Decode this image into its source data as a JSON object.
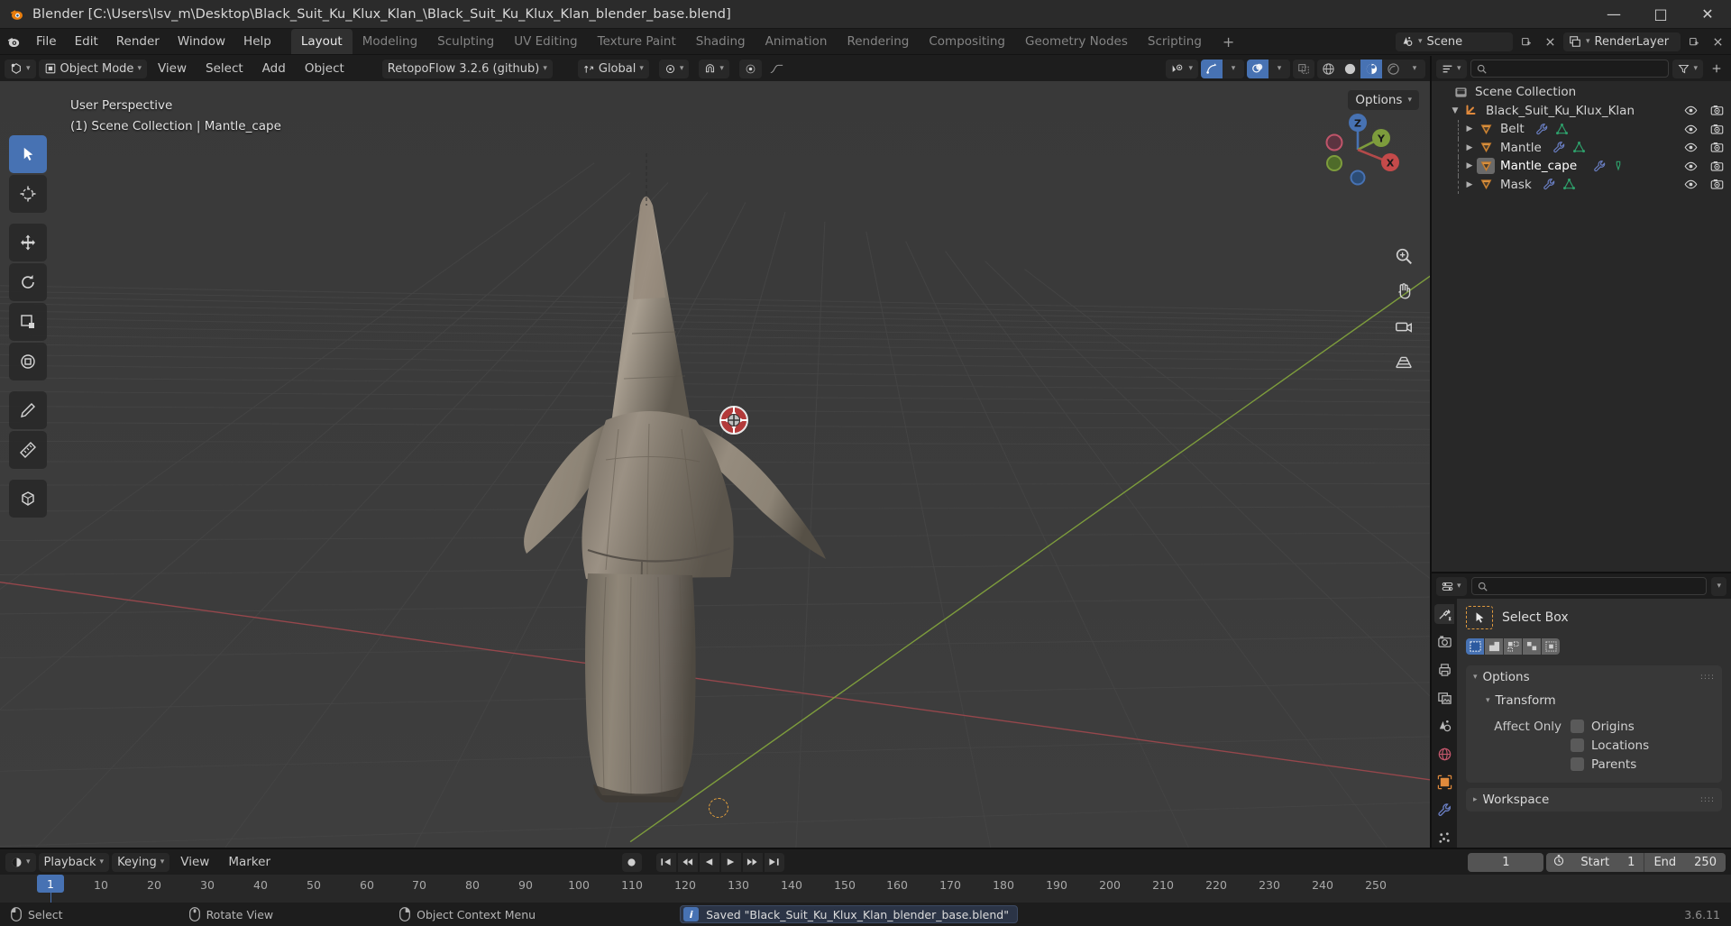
{
  "titlebar": {
    "app": "Blender",
    "title": "Blender [C:\\Users\\lsv_m\\Desktop\\Black_Suit_Ku_Klux_Klan_\\Black_Suit_Ku_Klux_Klan_blender_base.blend]",
    "minimize": "—",
    "maximize": "□",
    "close": "✕"
  },
  "menu": {
    "items": [
      "File",
      "Edit",
      "Render",
      "Window",
      "Help"
    ]
  },
  "workspaces": {
    "tabs": [
      "Layout",
      "Modeling",
      "Sculpting",
      "UV Editing",
      "Texture Paint",
      "Shading",
      "Animation",
      "Rendering",
      "Compositing",
      "Geometry Nodes",
      "Scripting"
    ],
    "active": "Layout",
    "add_label": "+"
  },
  "topbar_right": {
    "scene_name": "Scene",
    "viewlayer_name": "RenderLayer",
    "scene_icon": "scene-icon",
    "viewlayer_icon": "renderlayer-icon",
    "new_scene_icon": "new-scene-icon",
    "remove_scene_icon": "x-icon",
    "new_layer_icon": "new-layer-icon",
    "remove_layer_icon": "x-icon",
    "pin_icon": "pin-icon"
  },
  "viewport": {
    "header": {
      "editor_type_icon": "editor-type-3dview-icon",
      "mode": "Object Mode",
      "mode_icon": "object-mode-icon",
      "menus": [
        "View",
        "Select",
        "Add",
        "Object"
      ],
      "addon_menu": "RetopoFlow 3.2.6 (github)",
      "transform_orientation": "Global",
      "orientation_icon": "orientation-icon",
      "snap_magnet_icon": "magnet-icon",
      "snap_target_icon": "snap-target-icon",
      "proportional_icon": "proportional-edit-icon",
      "falloff_icon": "falloff-curve-icon",
      "pivot_icon": "pivot-point-icon",
      "visibility_icon": "object-visibility-icon",
      "gizmo_icon": "gizmo-icon",
      "overlays_icon": "overlays-icon",
      "xray_icon": "xray-toggle-icon",
      "shading_modes": [
        "wireframe",
        "solid",
        "material-preview",
        "rendered"
      ],
      "shading_active": "material-preview"
    },
    "overlay_line1": "User Perspective",
    "overlay_line2": "(1) Scene Collection | Mantle_cape",
    "options_label": "Options",
    "tools": [
      {
        "name": "tweak-select-tool",
        "icon": "cursor-arrow-icon",
        "active": true
      },
      {
        "name": "cursor-tool",
        "icon": "3d-cursor-icon",
        "active": false
      },
      {
        "name": "move-tool",
        "icon": "move-arrows-icon",
        "active": false
      },
      {
        "name": "rotate-tool",
        "icon": "rotate-icon",
        "active": false
      },
      {
        "name": "scale-tool",
        "icon": "scale-icon",
        "active": false
      },
      {
        "name": "transform-tool",
        "icon": "transform-icon",
        "active": false
      },
      {
        "name": "annotate-tool",
        "icon": "pencil-icon",
        "active": false
      },
      {
        "name": "measure-tool",
        "icon": "ruler-icon",
        "active": false
      },
      {
        "name": "add-cube-tool",
        "icon": "add-cube-icon",
        "active": false
      }
    ],
    "nav_gizmo": {
      "axes": [
        "X",
        "Y",
        "Z"
      ]
    },
    "nav_buttons": [
      {
        "name": "zoom-view-button",
        "icon": "magnifier-icon"
      },
      {
        "name": "pan-view-button",
        "icon": "hand-icon"
      },
      {
        "name": "camera-view-button",
        "icon": "camera-icon"
      },
      {
        "name": "toggle-ortho-button",
        "icon": "grid-perspective-icon"
      }
    ]
  },
  "outliner": {
    "header": {
      "display_mode_icon": "outliner-display-mode-icon",
      "filter_icon": "funnel-icon",
      "search_placeholder": "",
      "search_value": "",
      "search_icon": "search-icon"
    },
    "root": {
      "label": "Scene Collection",
      "icon": "collection-icon"
    },
    "collection": {
      "label": "Black_Suit_Ku_Klux_Klan",
      "icon": "empty-axis-icon",
      "expanded": true,
      "visible_icon": "eye-icon",
      "render_icon": "camera-render-icon"
    },
    "objects": [
      {
        "label": "Belt",
        "icon": "mesh-data-icon",
        "selected": false,
        "modifiers": [
          "wrench-icon",
          "mesh-triangle-icon"
        ],
        "visible_icon": "eye-icon",
        "render_icon": "camera-render-icon"
      },
      {
        "label": "Mantle",
        "icon": "mesh-data-icon",
        "selected": false,
        "modifiers": [
          "wrench-icon",
          "mesh-triangle-icon"
        ],
        "visible_icon": "eye-icon",
        "render_icon": "camera-render-icon"
      },
      {
        "label": "Mantle_cape",
        "icon": "mesh-data-icon",
        "selected": true,
        "modifiers": [
          "wrench-icon",
          "vertex-group-icon"
        ],
        "visible_icon": "eye-icon",
        "render_icon": "camera-render-icon"
      },
      {
        "label": "Mask",
        "icon": "mesh-data-icon",
        "selected": false,
        "modifiers": [
          "wrench-icon",
          "mesh-triangle-icon"
        ],
        "visible_icon": "eye-icon",
        "render_icon": "camera-render-icon"
      }
    ]
  },
  "properties": {
    "header": {
      "editor_icon": "properties-editor-icon",
      "search_placeholder": "",
      "search_icon": "search-icon",
      "options_caret": "chevron-down-icon"
    },
    "tabs": [
      {
        "name": "tool-tab",
        "icon": "tool-screwdriver-wrench-icon",
        "active": true
      },
      {
        "name": "render-tab",
        "icon": "camera-back-icon",
        "active": false
      },
      {
        "name": "output-tab",
        "icon": "printer-icon",
        "active": false
      },
      {
        "name": "viewlayer-tab",
        "icon": "images-icon",
        "active": false
      },
      {
        "name": "scene-tab",
        "icon": "cone-droplet-icon",
        "active": false
      },
      {
        "name": "world-tab",
        "icon": "world-globe-icon",
        "active": false
      },
      {
        "name": "object-tab",
        "icon": "orange-square-icon",
        "active": false
      },
      {
        "name": "modifier-tab",
        "icon": "wrench-icon",
        "active": false
      },
      {
        "name": "particles-tab",
        "icon": "particles-icon",
        "active": false
      }
    ],
    "active_tool": {
      "name": "Select Box",
      "icon": "select-box-icon",
      "modes": [
        "set",
        "extend",
        "subtract",
        "invert",
        "intersect"
      ],
      "active_mode": "set"
    },
    "panels": [
      {
        "label": "Options",
        "expanded": true,
        "icon": "chevron-down-icon",
        "sub": {
          "label": "Transform",
          "expanded": true,
          "icon": "chevron-down-icon",
          "affect_only_label": "Affect Only",
          "checkboxes": [
            {
              "label": "Origins",
              "checked": false
            },
            {
              "label": "Locations",
              "checked": false
            },
            {
              "label": "Parents",
              "checked": false
            }
          ]
        }
      },
      {
        "label": "Workspace",
        "expanded": false,
        "icon": "chevron-right-icon"
      }
    ]
  },
  "timeline": {
    "editor_icon": "timeline-editor-icon",
    "menus": [
      "Playback",
      "Keying",
      "View",
      "Marker"
    ],
    "record_icon": "record-keyframes-icon",
    "transport": [
      {
        "name": "jump-to-start-button",
        "icon": "jump-start-icon"
      },
      {
        "name": "jump-prev-keyframe-button",
        "icon": "prev-keyframe-icon"
      },
      {
        "name": "play-reverse-button",
        "icon": "play-reverse-icon"
      },
      {
        "name": "play-button",
        "icon": "play-icon"
      },
      {
        "name": "jump-next-keyframe-button",
        "icon": "next-keyframe-icon"
      },
      {
        "name": "jump-to-end-button",
        "icon": "jump-end-icon"
      }
    ],
    "current_frame": "1",
    "use_preview_range_icon": "stopwatch-icon",
    "start_label": "Start",
    "start_value": "1",
    "end_label": "End",
    "end_value": "250",
    "playhead_frame": "1",
    "ticks": [
      1,
      10,
      20,
      30,
      40,
      50,
      60,
      70,
      80,
      90,
      100,
      110,
      120,
      130,
      140,
      150,
      160,
      170,
      180,
      190,
      200,
      210,
      220,
      230,
      240,
      250
    ]
  },
  "statusbar": {
    "hints": [
      {
        "label": "Select",
        "icon": "mouse-left-icon"
      },
      {
        "label": "Rotate View",
        "icon": "mouse-middle-icon"
      },
      {
        "label": "Object Context Menu",
        "icon": "mouse-right-icon"
      }
    ],
    "report": "Saved \"Black_Suit_Ku_Klux_Klan_blender_base.blend\"",
    "report_icon": "info-icon",
    "version": "3.6.11"
  },
  "colors": {
    "accent_blue": "#4772b3",
    "panel_bg": "#303030",
    "editor_bg": "#282828",
    "header_bg": "#1d1d1d",
    "viewport_bg": "#393939",
    "axis_x": "#9c4a4f",
    "axis_y": "#7a9c3f",
    "orange": "#e08a3c",
    "mesh_green": "#3aa86f"
  }
}
